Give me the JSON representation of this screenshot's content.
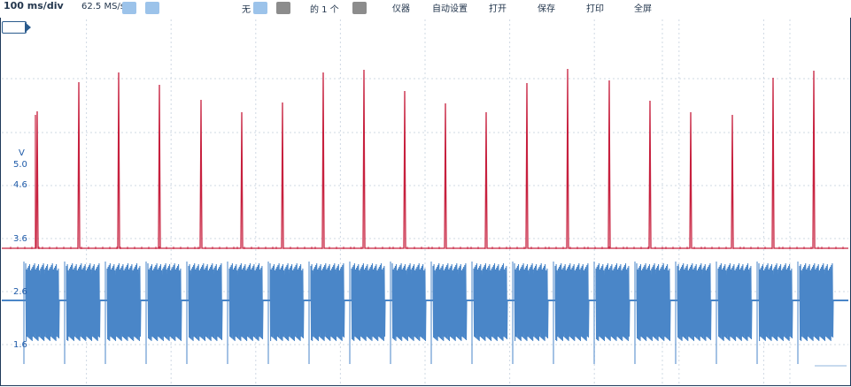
{
  "toolbar": {
    "timebase": "100 ms/div",
    "sample_rate": "62.5 MS/s",
    "trigger_label": "无",
    "captures_label": "的 1 个",
    "menu": [
      "仪器",
      "自动设置",
      "打开",
      "保存",
      "打印",
      "全屏"
    ]
  },
  "axis": {
    "unit": "V",
    "ticks": [
      "5.0",
      "4.6",
      "3.6",
      "2.6",
      "1.6"
    ]
  },
  "colors": {
    "channel_a": "#c7203e",
    "channel_b": "#4a86c8",
    "grid": "#cfd8e3",
    "frame": "#1f3a5a"
  }
}
